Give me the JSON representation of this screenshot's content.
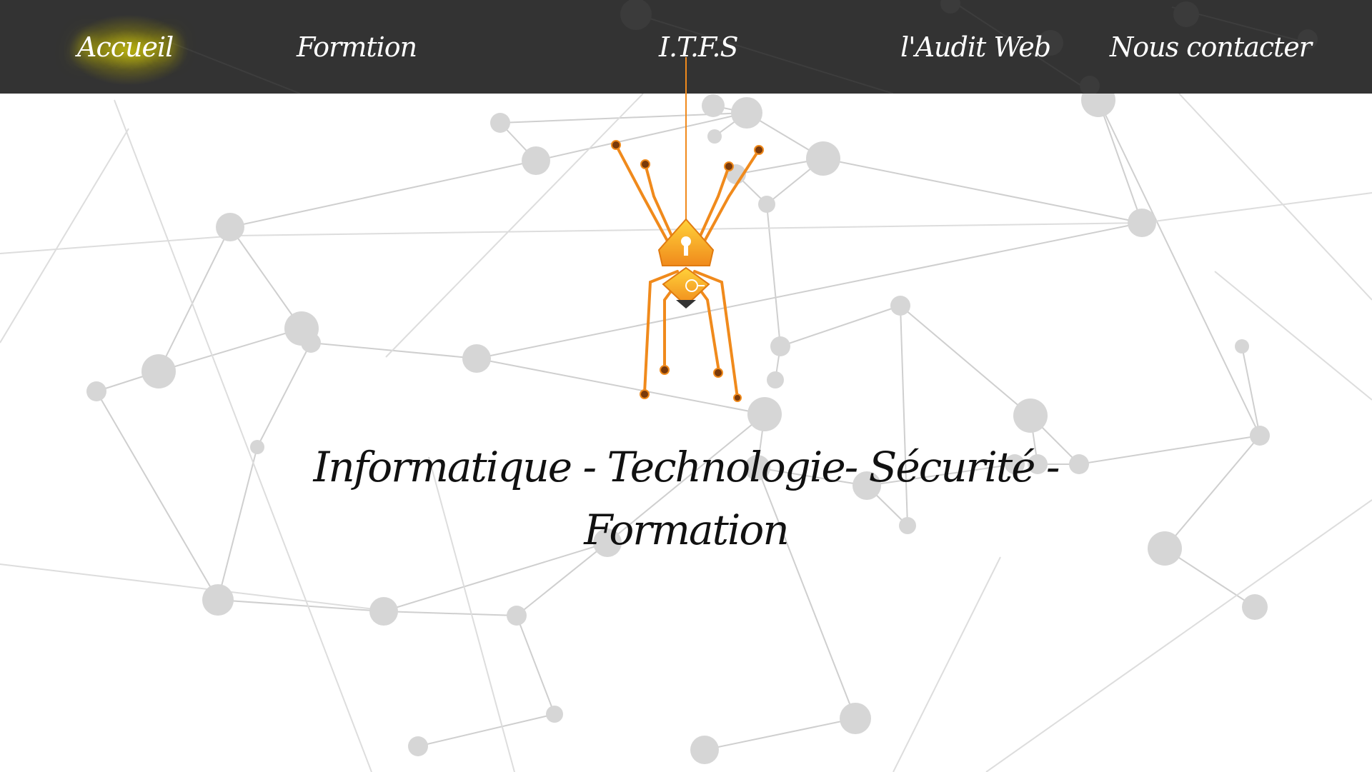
{
  "nav": {
    "items": [
      {
        "label": "Accueil",
        "active": true
      },
      {
        "label": "Formtion",
        "active": false
      },
      {
        "label": "I.T.F.S",
        "active": false
      },
      {
        "label": "l'Audit Web",
        "active": false
      },
      {
        "label": "Nous contacter",
        "active": false
      }
    ]
  },
  "hero": {
    "tagline_line1": "Informatique - Technologie- Sécurité -",
    "tagline_line2": "Formation",
    "logo_icon": "spider-lock-icon"
  },
  "colors": {
    "navbar_bg": "#333333",
    "nav_text": "#ffffff",
    "active_glow": "#d8d000",
    "spider_orange": "#f08a1c",
    "spider_yellow": "#ffd23a",
    "network_line": "#cfcfcf",
    "network_node": "#d6d6d6"
  }
}
